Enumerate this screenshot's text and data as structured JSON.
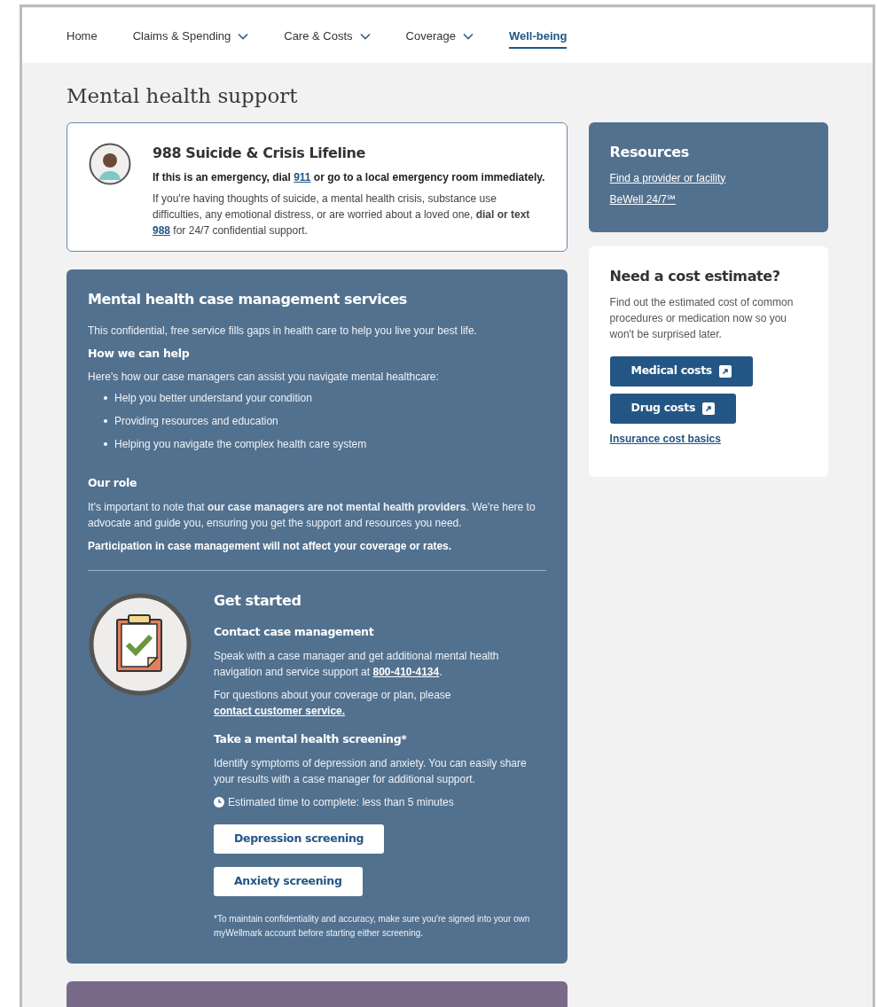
{
  "nav": [
    {
      "label": "Home",
      "dropdown": false,
      "selected": false
    },
    {
      "label": "Claims & Spending",
      "dropdown": true,
      "selected": false
    },
    {
      "label": "Care & Costs",
      "dropdown": true,
      "selected": false
    },
    {
      "label": "Coverage",
      "dropdown": true,
      "selected": false
    },
    {
      "label": "Well-being",
      "dropdown": false,
      "selected": true
    }
  ],
  "page_title": "Mental health support",
  "crisis_card": {
    "title": "988 Suicide & Crisis Lifeline",
    "emergency": [
      {
        "kind": "text",
        "text": "If this is an emergency, dial "
      },
      {
        "kind": "link",
        "text": "911"
      },
      {
        "kind": "text",
        "text": " or go to a local emergency room immediately."
      }
    ],
    "body": [
      {
        "kind": "text",
        "text": "If you're having thoughts of suicide, a mental health crisis, substance use difficulties, any emotional distress, or are worried about a loved one, "
      },
      {
        "kind": "bold",
        "text": "dial or text "
      },
      {
        "kind": "link",
        "text": "988"
      },
      {
        "kind": "text",
        "text": " for 24/7 confidential support."
      }
    ]
  },
  "case_management": {
    "title": "Mental health case management services",
    "intro": "This confidential, free service fills gaps in health care to help you live your best life.",
    "help_heading": "How we can help",
    "help_intro": "Here's how our case managers can assist you navigate mental healthcare:",
    "bullets": [
      "Help you better understand your condition",
      "Providing resources and education",
      "Helping you navigate the complex health care system"
    ],
    "role_heading": "Our role",
    "role_text": [
      {
        "kind": "text",
        "text": "It's important to note that "
      },
      {
        "kind": "bold",
        "text": "our case managers are not mental health providers"
      },
      {
        "kind": "text",
        "text": ". We're here to advocate and guide you, ensuring you get the support and resources you need."
      }
    ],
    "participation": "Participation in case management will not affect your coverage or rates.",
    "get_started": {
      "title": "Get started",
      "contact_heading": "Contact case management",
      "contact_text": [
        {
          "kind": "text",
          "text": "Speak with a case manager and get additional mental health navigation and service support at "
        },
        {
          "kind": "link",
          "text": "800-410-4134"
        },
        {
          "kind": "text",
          "text": "."
        }
      ],
      "questions_text": [
        {
          "kind": "text",
          "text": "For questions about your coverage or plan, please "
        },
        {
          "kind": "link",
          "text": "contact customer service."
        }
      ],
      "screening_heading": "Take a mental health screening*",
      "screening_text": "Identify symptoms of depression and anxiety. You can easily share your results with a case manager for additional support.",
      "time_note": "Estimated time to complete: less than 5 minutes",
      "buttons": [
        "Depression screening",
        "Anxiety screening"
      ],
      "footnote": "*To maintain confidentiality and accuracy, make sure you're signed into your own myWellmark account before starting either screening."
    }
  },
  "resources": {
    "title": "Resources",
    "links": [
      "Find a provider or facility",
      "BeWell 24/7℠"
    ]
  },
  "cost_estimate": {
    "title": "Need a cost estimate?",
    "text": "Find out the estimated cost of common procedures or medication now so you won't be surprised later.",
    "buttons": [
      "Medical costs",
      "Drug costs"
    ],
    "link": "Insurance cost basics"
  }
}
